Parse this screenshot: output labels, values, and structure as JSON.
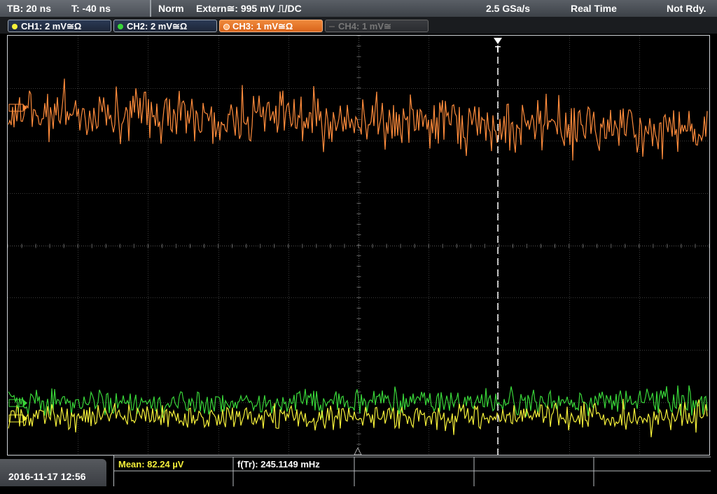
{
  "status": {
    "timebase": "TB: 20 ns",
    "trigger_offset": "T: -40 ns",
    "mode": "Norm",
    "trigger_source": "Extern≅: 995 mV ⎍/DC",
    "sample_rate": "2.5 GSa/s",
    "acquisition": "Real Time",
    "ready_state": "Not Rdy."
  },
  "channels": [
    {
      "label": "CH1: 2 mV≅Ω",
      "color": "#f5f03a",
      "state": "on"
    },
    {
      "label": "CH2: 2 mV≅Ω",
      "color": "#39d639",
      "state": "on"
    },
    {
      "label": "CH3: 1 mV≅Ω",
      "color": "#ff8c3c",
      "state": "active"
    },
    {
      "label": "CH4: 1 mV≅",
      "color": "#777777",
      "state": "off"
    }
  ],
  "trigger_marker": "T",
  "measurements": {
    "mean": "Mean: 82.24 µV",
    "frequency": "f(Tr): 245.1149 mHz"
  },
  "datetime": "2016-11-17 12:56",
  "trace_colors": {
    "ch1": "#f5f03a",
    "ch2": "#39d639",
    "ch3": "#ff8c3c"
  }
}
